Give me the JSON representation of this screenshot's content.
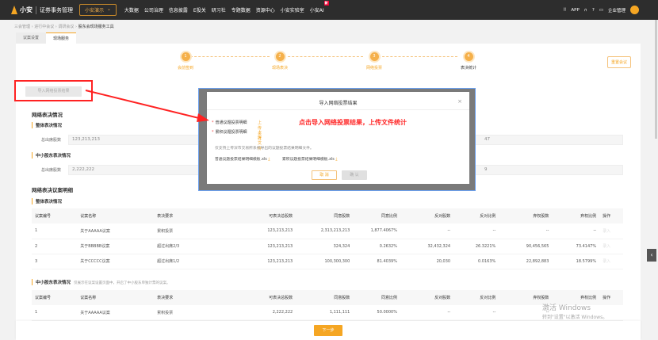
{
  "header": {
    "logo": "小安",
    "system": "证券事务管理",
    "org_select": "小安演示",
    "nav": [
      "大数据",
      "公司治理",
      "信息披露",
      "E投关",
      "研习社",
      "专题数据",
      "资源中心",
      "小安实验室",
      "小安AI"
    ],
    "new_badge": "新",
    "app": "APP",
    "user_menu": "企业管理"
  },
  "breadcrumb": [
    "三会管理",
    "进行中会议",
    "调研会议",
    "股东会现场服务工具"
  ],
  "tabs": [
    "议案设置",
    "现场服务"
  ],
  "steps": [
    "会前签到",
    "现场表决",
    "网络投票",
    "表决统计"
  ],
  "reset_button": "重置会议",
  "import_button": "导入网络投票结果",
  "network": {
    "title": "网络表决情况",
    "overall": "整体表决情况",
    "total_label": "总出席股数",
    "overall_total": "123,213,213",
    "overall_right": "47",
    "small": "中小股东表决情况",
    "small_total": "2,222,222",
    "small_right": "9"
  },
  "detail": {
    "title": "网络表决议案明细",
    "overall": "整体表决情况",
    "columns": [
      "议案编号",
      "议案名称",
      "表决要求",
      "可表决总股数",
      "同意股数",
      "同意比例",
      "反对股数",
      "反对比例",
      "弃权股数",
      "弃权比例",
      "操作"
    ],
    "rows": [
      [
        "1",
        "关于AAAAA议案",
        "累积投票",
        "123,213,213",
        "2,313,213,213",
        "1,877.4067%",
        "--",
        "--",
        "--",
        "--",
        "录入"
      ],
      [
        "2",
        "关于BBBBB议案",
        "超过出席2/3",
        "123,213,213",
        "324,324",
        "0.2632%",
        "32,432,324",
        "26.3221%",
        "90,456,565",
        "73.4147%",
        "录入"
      ],
      [
        "3",
        "关于CCCCC议案",
        "超过出席1/2",
        "123,213,213",
        "100,300,300",
        "81.4039%",
        "20,030",
        "0.0163%",
        "22,892,883",
        "18.5799%",
        "录入"
      ]
    ],
    "small": "中小股东表决情况",
    "small_note": "仅展示在议案设置页面中，开启了中小股东单独计票的议案。",
    "small_rows": [
      [
        "1",
        "关于AAAAA议案",
        "累积投票",
        "2,222,222",
        "1,111,111",
        "50.0000%",
        "--",
        "--",
        "--",
        "",
        ""
      ]
    ]
  },
  "next_button": "下一步",
  "watermark": {
    "line1": "激活 Windows",
    "line2": "转到\"设置\"以激活 Windows。"
  },
  "modal": {
    "title": "导入网络投票结果",
    "row1": "普通议题投票明细",
    "row2": "累积议题投票明细",
    "upload": "上传文件",
    "note": "仅支持上传深市交易所系统导出的议题投票结果明细文件。",
    "tpl1": "普通议题投票结果明细模板.xls",
    "tpl2": "累积议题投票结果明细模板.xls",
    "cancel": "取 消",
    "ok": "确 认"
  },
  "annotation": "点击导入网络投票结果，上传文件统计"
}
